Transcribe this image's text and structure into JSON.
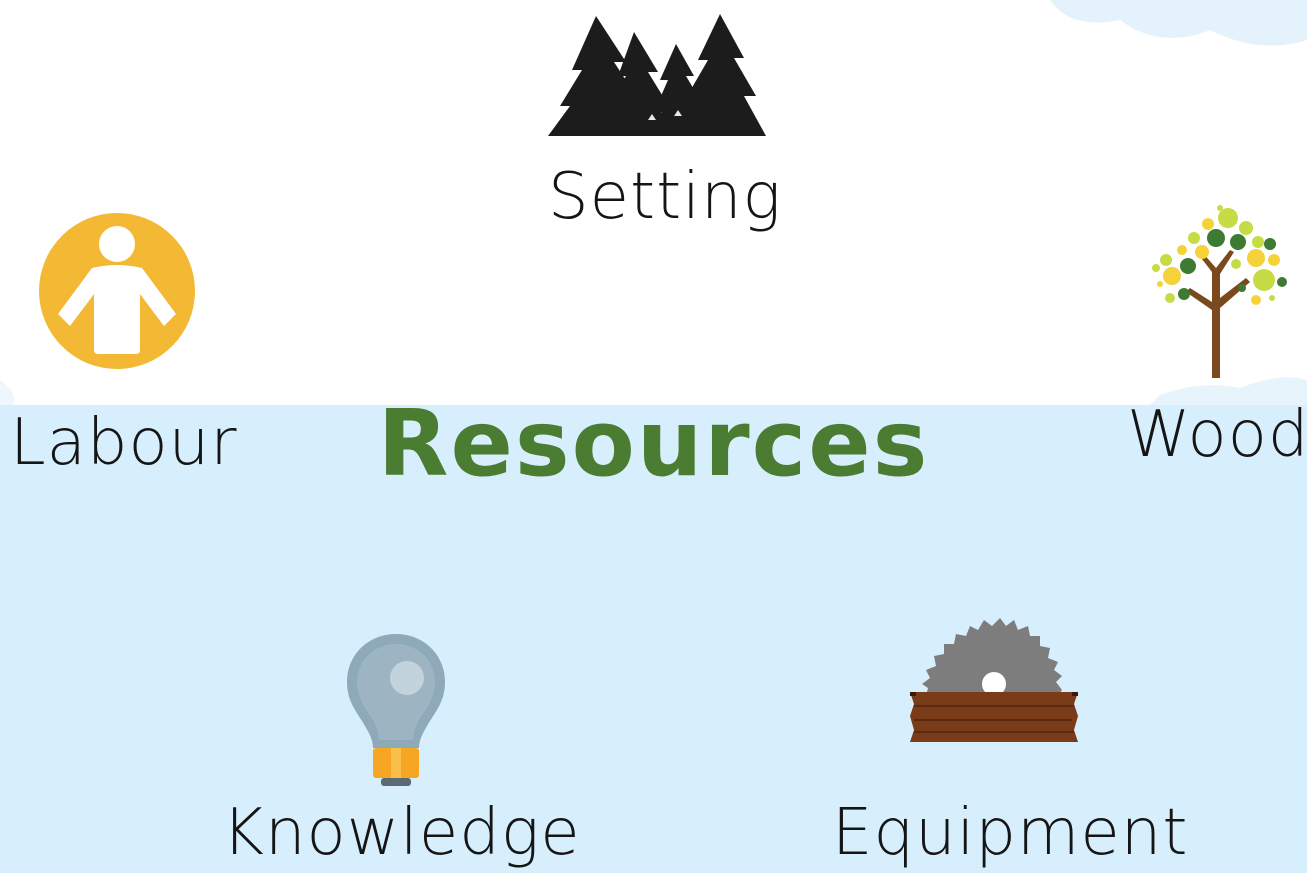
{
  "title": {
    "text": "Resources",
    "color": "#4a7c32"
  },
  "nodes": {
    "setting": {
      "label": "Setting",
      "icon": "pine-trees-icon"
    },
    "labour": {
      "label": "Labour",
      "icon": "person-icon",
      "color": "#f4b934"
    },
    "wood": {
      "label": "Wood",
      "icon": "tree-icon"
    },
    "knowledge": {
      "label": "Knowledge",
      "icon": "lightbulb-icon"
    },
    "equipment": {
      "label": "Equipment",
      "icon": "saw-blade-icon"
    }
  },
  "colors": {
    "top_background": "#ffffff",
    "bottom_background": "#d7effc",
    "text": "#151515"
  }
}
